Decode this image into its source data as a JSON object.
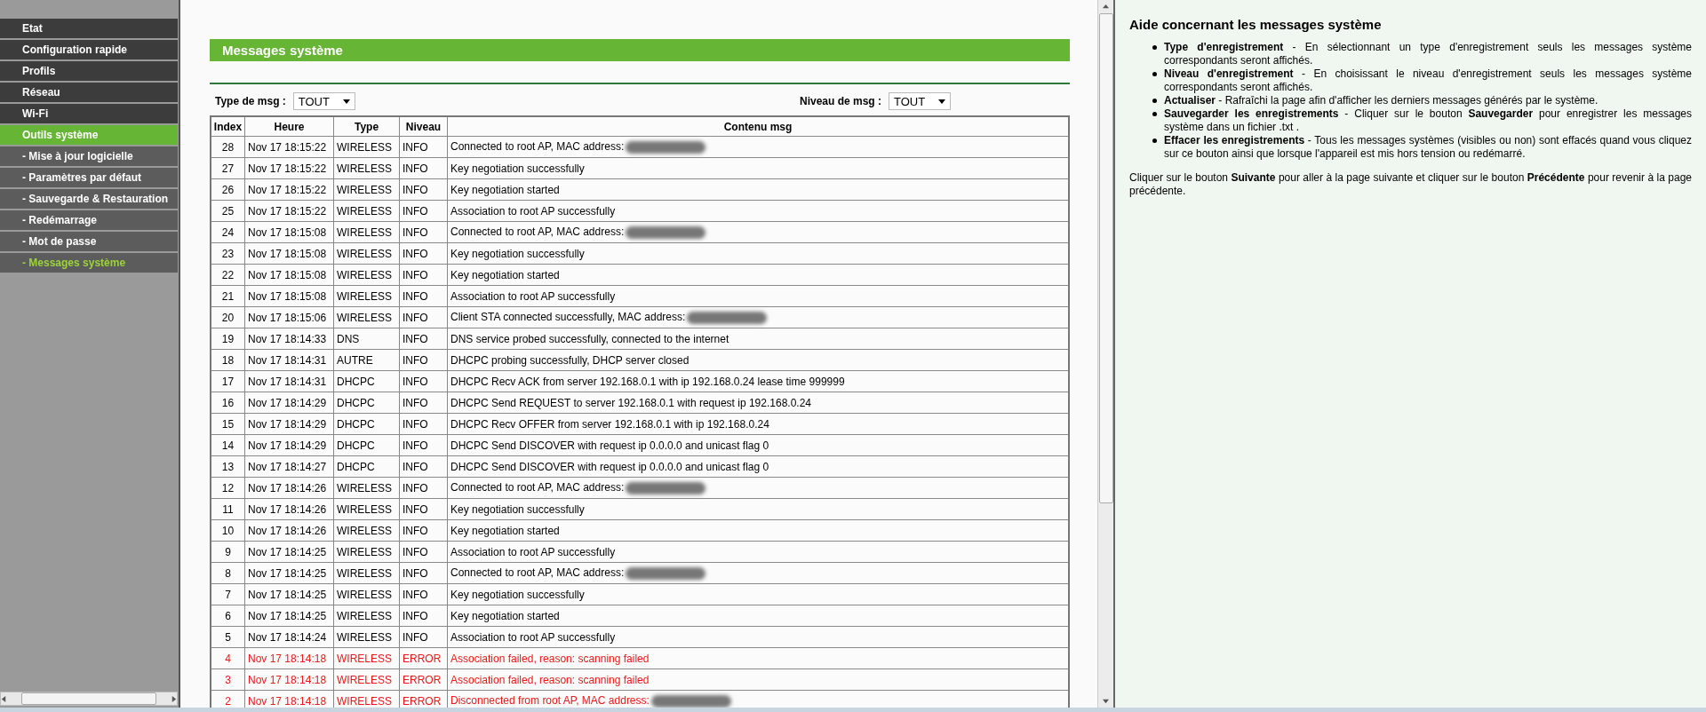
{
  "sidebar": {
    "items": [
      {
        "label": "Etat",
        "expanded": false
      },
      {
        "label": "Configuration rapide",
        "expanded": false
      },
      {
        "label": "Profils",
        "expanded": false
      },
      {
        "label": "Réseau",
        "expanded": false
      },
      {
        "label": "Wi-Fi",
        "expanded": false
      },
      {
        "label": "Outils système",
        "expanded": true,
        "children": [
          {
            "label": "- Mise à jour logicielle",
            "selected": false
          },
          {
            "label": "- Paramètres par défaut",
            "selected": false
          },
          {
            "label": "- Sauvegarde & Restauration",
            "selected": false
          },
          {
            "label": "- Redémarrage",
            "selected": false
          },
          {
            "label": "- Mot de passe",
            "selected": false
          },
          {
            "label": "- Messages système",
            "selected": true
          }
        ]
      }
    ]
  },
  "main": {
    "title": "Messages système",
    "filters": [
      {
        "label": "Type de msg :",
        "value": "TOUT"
      },
      {
        "label": "Niveau de msg :",
        "value": "TOUT"
      }
    ],
    "table": {
      "columns": [
        "Index",
        "Heure",
        "Type",
        "Niveau",
        "Contenu msg"
      ],
      "rows": [
        {
          "index": "28",
          "time": "Nov 17 18:15:22",
          "type": "WIRELESS",
          "level": "INFO",
          "content": "Connected to root AP, MAC address:",
          "kind": "info",
          "redacted": true
        },
        {
          "index": "27",
          "time": "Nov 17 18:15:22",
          "type": "WIRELESS",
          "level": "INFO",
          "content": "Key negotiation successfully",
          "kind": "info",
          "redacted": false
        },
        {
          "index": "26",
          "time": "Nov 17 18:15:22",
          "type": "WIRELESS",
          "level": "INFO",
          "content": "Key negotiation started",
          "kind": "info",
          "redacted": false
        },
        {
          "index": "25",
          "time": "Nov 17 18:15:22",
          "type": "WIRELESS",
          "level": "INFO",
          "content": "Association to root AP successfully",
          "kind": "info",
          "redacted": false
        },
        {
          "index": "24",
          "time": "Nov 17 18:15:08",
          "type": "WIRELESS",
          "level": "INFO",
          "content": "Connected to root AP, MAC address:",
          "kind": "info",
          "redacted": true
        },
        {
          "index": "23",
          "time": "Nov 17 18:15:08",
          "type": "WIRELESS",
          "level": "INFO",
          "content": "Key negotiation successfully",
          "kind": "info",
          "redacted": false
        },
        {
          "index": "22",
          "time": "Nov 17 18:15:08",
          "type": "WIRELESS",
          "level": "INFO",
          "content": "Key negotiation started",
          "kind": "info",
          "redacted": false
        },
        {
          "index": "21",
          "time": "Nov 17 18:15:08",
          "type": "WIRELESS",
          "level": "INFO",
          "content": "Association to root AP successfully",
          "kind": "info",
          "redacted": false
        },
        {
          "index": "20",
          "time": "Nov 17 18:15:06",
          "type": "WIRELESS",
          "level": "INFO",
          "content": "Client STA connected successfully, MAC address:",
          "kind": "info",
          "redacted": true
        },
        {
          "index": "19",
          "time": "Nov 17 18:14:33",
          "type": "DNS",
          "level": "INFO",
          "content": "DNS service probed successfully, connected to the internet",
          "kind": "info",
          "redacted": false
        },
        {
          "index": "18",
          "time": "Nov 17 18:14:31",
          "type": "AUTRE",
          "level": "INFO",
          "content": "DHCPC probing successfully, DHCP server closed",
          "kind": "info",
          "redacted": false
        },
        {
          "index": "17",
          "time": "Nov 17 18:14:31",
          "type": "DHCPC",
          "level": "INFO",
          "content": "DHCPC Recv ACK from server 192.168.0.1 with ip 192.168.0.24 lease time 999999",
          "kind": "info",
          "redacted": false
        },
        {
          "index": "16",
          "time": "Nov 17 18:14:29",
          "type": "DHCPC",
          "level": "INFO",
          "content": "DHCPC Send REQUEST to server 192.168.0.1 with request ip 192.168.0.24",
          "kind": "info",
          "redacted": false
        },
        {
          "index": "15",
          "time": "Nov 17 18:14:29",
          "type": "DHCPC",
          "level": "INFO",
          "content": "DHCPC Recv OFFER from server 192.168.0.1 with ip 192.168.0.24",
          "kind": "info",
          "redacted": false
        },
        {
          "index": "14",
          "time": "Nov 17 18:14:29",
          "type": "DHCPC",
          "level": "INFO",
          "content": "DHCPC Send DISCOVER with request ip 0.0.0.0 and unicast flag 0",
          "kind": "info",
          "redacted": false
        },
        {
          "index": "13",
          "time": "Nov 17 18:14:27",
          "type": "DHCPC",
          "level": "INFO",
          "content": "DHCPC Send DISCOVER with request ip 0.0.0.0 and unicast flag 0",
          "kind": "info",
          "redacted": false
        },
        {
          "index": "12",
          "time": "Nov 17 18:14:26",
          "type": "WIRELESS",
          "level": "INFO",
          "content": "Connected to root AP, MAC address:",
          "kind": "info",
          "redacted": true
        },
        {
          "index": "11",
          "time": "Nov 17 18:14:26",
          "type": "WIRELESS",
          "level": "INFO",
          "content": "Key negotiation successfully",
          "kind": "info",
          "redacted": false
        },
        {
          "index": "10",
          "time": "Nov 17 18:14:26",
          "type": "WIRELESS",
          "level": "INFO",
          "content": "Key negotiation started",
          "kind": "info",
          "redacted": false
        },
        {
          "index": "9",
          "time": "Nov 17 18:14:25",
          "type": "WIRELESS",
          "level": "INFO",
          "content": "Association to root AP successfully",
          "kind": "info",
          "redacted": false
        },
        {
          "index": "8",
          "time": "Nov 17 18:14:25",
          "type": "WIRELESS",
          "level": "INFO",
          "content": "Connected to root AP, MAC address:",
          "kind": "info",
          "redacted": true
        },
        {
          "index": "7",
          "time": "Nov 17 18:14:25",
          "type": "WIRELESS",
          "level": "INFO",
          "content": "Key negotiation successfully",
          "kind": "info",
          "redacted": false
        },
        {
          "index": "6",
          "time": "Nov 17 18:14:25",
          "type": "WIRELESS",
          "level": "INFO",
          "content": "Key negotiation started",
          "kind": "info",
          "redacted": false
        },
        {
          "index": "5",
          "time": "Nov 17 18:14:24",
          "type": "WIRELESS",
          "level": "INFO",
          "content": "Association to root AP successfully",
          "kind": "info",
          "redacted": false
        },
        {
          "index": "4",
          "time": "Nov 17 18:14:18",
          "type": "WIRELESS",
          "level": "ERROR",
          "content": "Association failed, reason: scanning failed",
          "kind": "error",
          "redacted": false
        },
        {
          "index": "3",
          "time": "Nov 17 18:14:18",
          "type": "WIRELESS",
          "level": "ERROR",
          "content": "Association failed, reason: scanning failed",
          "kind": "error",
          "redacted": false
        },
        {
          "index": "2",
          "time": "Nov 17 18:14:18",
          "type": "WIRELESS",
          "level": "ERROR",
          "content": "Disconnected from root AP, MAC address:",
          "kind": "error",
          "redacted": true
        }
      ]
    }
  },
  "help": {
    "title": "Aide concernant les messages système",
    "items": [
      "**Type d'enregistrement** - En sélectionnant un type d'enregistrement seuls les messages système correspondants seront affichés.",
      "**Niveau d'enregistrement** - En choisissant le niveau d'enregistrement seuls les messages système correspondants seront affichés.",
      "**Actualiser** - Rafraîchi la page afin d'afficher les derniers messages générés par le système.",
      "**Sauvegarder les enregistrements** - Cliquer sur le bouton **Sauvegarder** pour enregistrer les messages système dans un fichier .txt .",
      "**Effacer les enregistrements** - Tous les messages systèmes (visibles ou non) sont effacés quand vous cliquez sur ce bouton ainsi que lorsque l'appareil est mis hors tension ou redémarré."
    ],
    "note": "Cliquer sur le bouton **Suivante** pour aller à la page suivante et cliquer sur le bouton **Précédente** pour revenir à la page précédente."
  }
}
